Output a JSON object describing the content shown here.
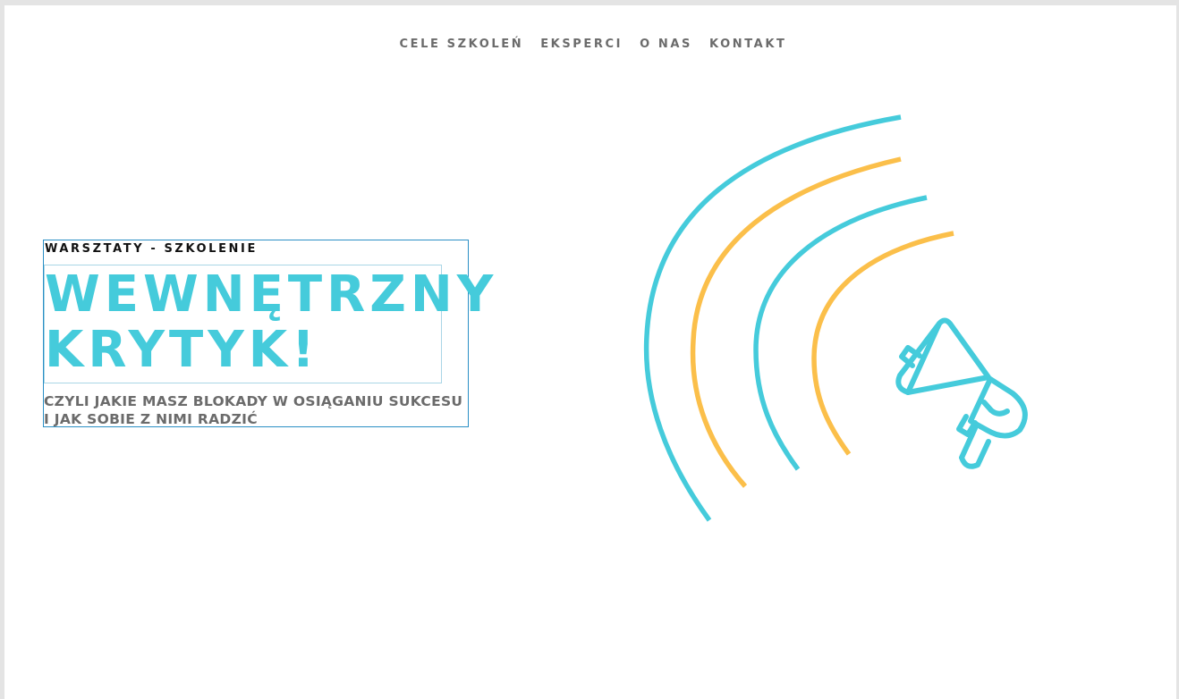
{
  "nav": {
    "items": [
      {
        "label": "CELE SZKOLEŃ"
      },
      {
        "label": "EKSPERCI"
      },
      {
        "label": "O NAS"
      },
      {
        "label": "KONTAKT"
      }
    ]
  },
  "hero": {
    "eyebrow": "WARSZTATY - SZKOLENIE",
    "title_line1": "WEWNĘTRZNY",
    "title_line2": "KRYTYK!",
    "subtitle_line1": "CZYLI  JAKIE MASZ BLOKADY W OSIĄGANIU SUKCESU",
    "subtitle_line2": "I JAK SOBIE Z NIMI RADZIĆ"
  },
  "colors": {
    "accent_cyan": "#45cbdb",
    "accent_yellow": "#fbbf4a",
    "text_gray": "#6b6b6b",
    "text_dark": "#111111"
  },
  "illustration": {
    "icon": "megaphone-icon"
  }
}
